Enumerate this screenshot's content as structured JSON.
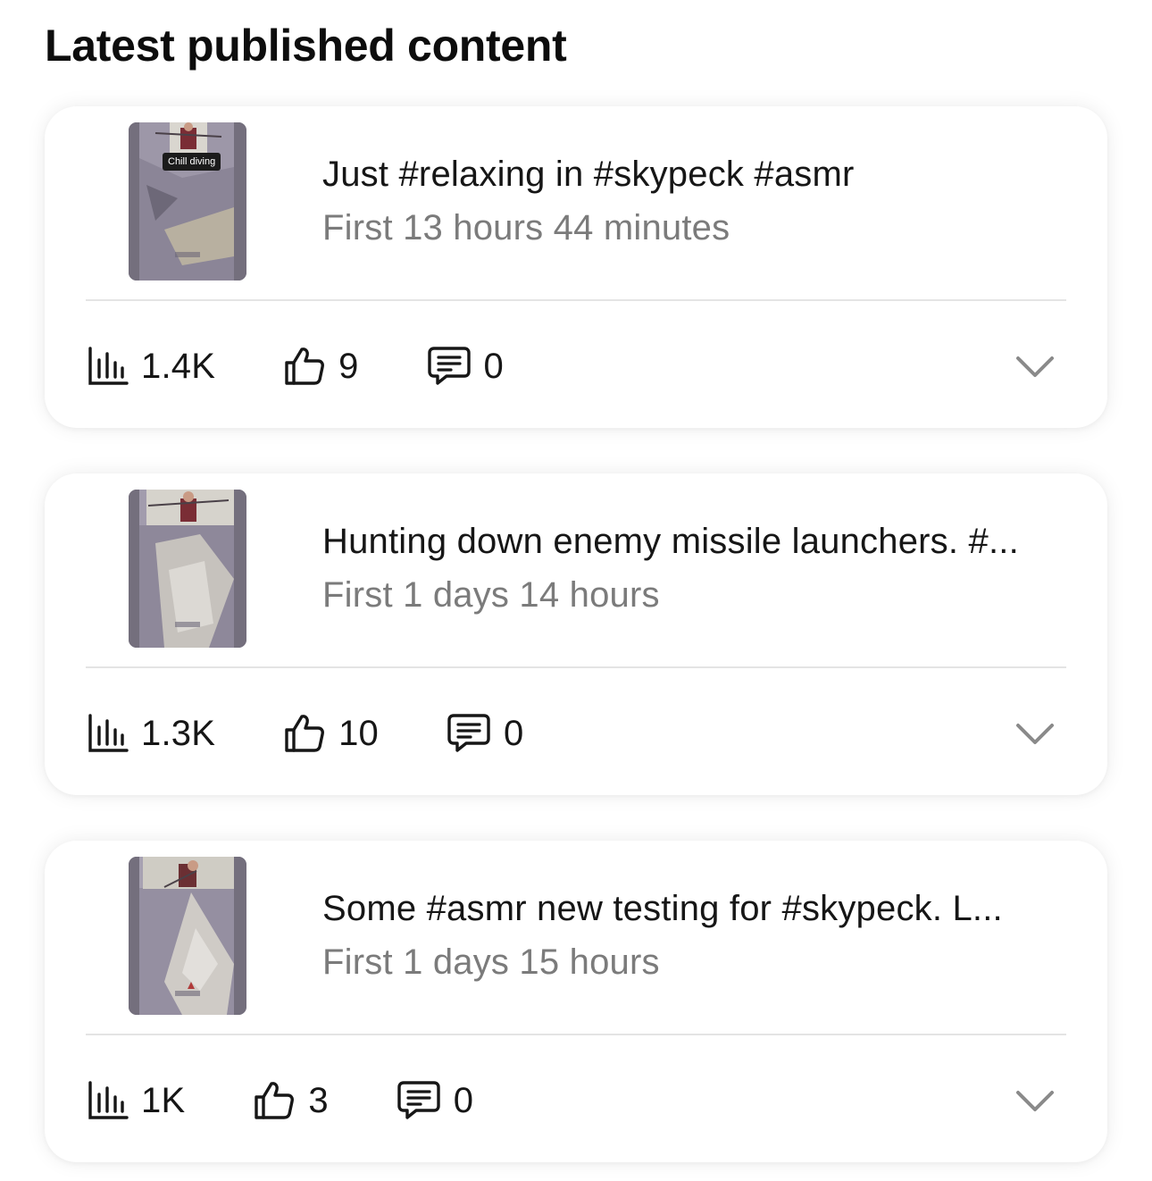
{
  "header": {
    "title": "Latest published content"
  },
  "posts": [
    {
      "title": "Just #relaxing in #skypeck #asmr",
      "age": "First 13 hours 44 minutes",
      "thumb_caption": "Chill diving",
      "views": "1.4K",
      "likes": "9",
      "comments": "0"
    },
    {
      "title": "Hunting down enemy missile launchers. #...",
      "age": "First 1 days 14 hours",
      "views": "1.3K",
      "likes": "10",
      "comments": "0"
    },
    {
      "title": "Some #asmr new testing for #skypeck. L...",
      "age": "First 1 days 15 hours",
      "views": "1K",
      "likes": "3",
      "comments": "0"
    }
  ],
  "icons": {
    "views": "bar-chart-icon",
    "likes": "thumbs-up-icon",
    "comments": "comment-icon",
    "expand": "chevron-down-icon"
  }
}
